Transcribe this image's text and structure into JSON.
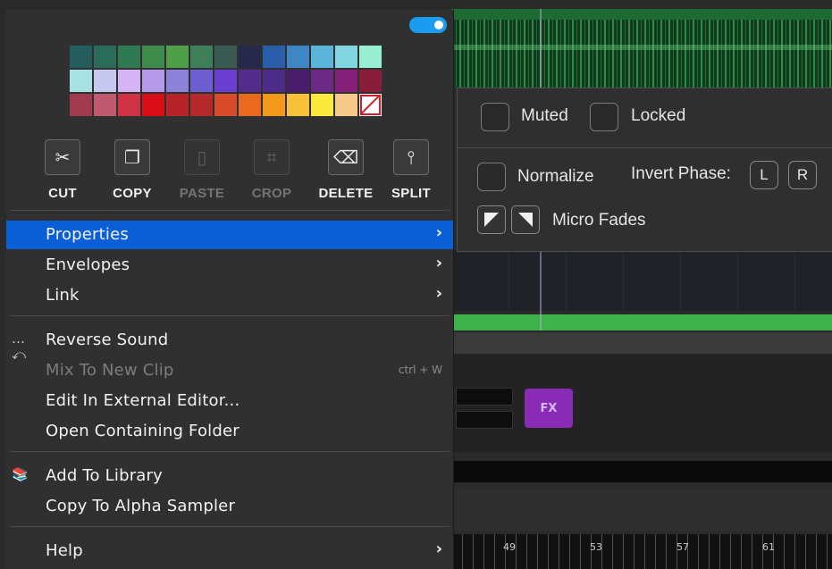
{
  "colors": {
    "accent_toggle": "#1b9cf0",
    "selected_item": "#0a5fd6",
    "fx_button": "#8a2bb5",
    "swatches": [
      "#255d5c",
      "#2b6b5a",
      "#2f7a52",
      "#3f8b4c",
      "#4f9e4a",
      "#3e7e58",
      "#3b5a53",
      "#26294a",
      "#2a5ea8",
      "#3f86c5",
      "#5cb5d9",
      "#82d6df",
      "#98eed3",
      "#a7e1e2",
      "#c6c7ef",
      "#d4b4f3",
      "#b49ae8",
      "#8d82d9",
      "#6b5fd1",
      "#6a3ed0",
      "#532c8e",
      "#4d2b88",
      "#4a1c6e",
      "#6b2b85",
      "#84207a",
      "#891e3b",
      "#a23b50",
      "#c05a70",
      "#cf3343",
      "#d80d15",
      "#b6242a",
      "#b42a2a",
      "#d84b2a",
      "#e76a1e",
      "#f39a1c",
      "#f7c03a",
      "#f7ea3d",
      "#f5c98a",
      "none"
    ]
  },
  "toggle": {
    "state": "on"
  },
  "tools": [
    {
      "icon": "scissors-icon",
      "glyph": "✂",
      "label": "CUT",
      "enabled": true
    },
    {
      "icon": "copy-icon",
      "glyph": "❐",
      "label": "COPY",
      "enabled": true
    },
    {
      "icon": "paste-icon",
      "glyph": "▯",
      "label": "PASTE",
      "enabled": false
    },
    {
      "icon": "crop-icon",
      "glyph": "⌗",
      "label": "CROP",
      "enabled": false
    },
    {
      "icon": "delete-icon",
      "glyph": "⌫",
      "label": "DELETE",
      "enabled": true
    },
    {
      "icon": "split-icon",
      "glyph": "⫯",
      "label": "SPLIT",
      "enabled": true
    }
  ],
  "menu": {
    "items": [
      {
        "label": "Properties",
        "submenu": true,
        "selected": true
      },
      {
        "label": "Envelopes",
        "submenu": true
      },
      {
        "label": "Link",
        "submenu": true
      },
      {
        "label": "Reverse Sound",
        "icon": "reverse-icon"
      },
      {
        "label": "Mix To New Clip",
        "shortcut": "ctrl + W",
        "enabled": false
      },
      {
        "label": "Edit In External Editor..."
      },
      {
        "label": "Open Containing Folder"
      },
      {
        "label": "Add To Library",
        "icon": "library-icon"
      },
      {
        "label": "Copy To Alpha Sampler"
      },
      {
        "label": "Help",
        "submenu": true
      }
    ]
  },
  "submenu": {
    "muted": "Muted",
    "locked": "Locked",
    "normalize": "Normalize",
    "invert_phase": "Invert Phase:",
    "phase_left": "L",
    "phase_right": "R",
    "micro_fades": "Micro Fades"
  },
  "background": {
    "fx_label": "FX",
    "ruler_numbers": [
      "49",
      "53",
      "57",
      "61"
    ]
  }
}
